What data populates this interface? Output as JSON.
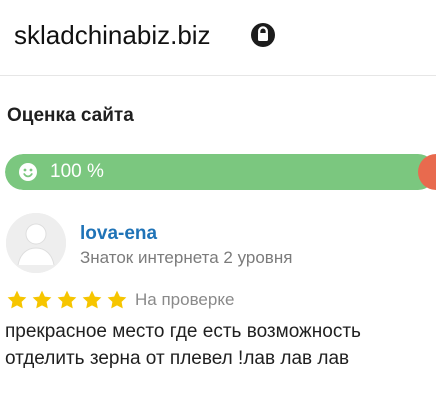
{
  "header": {
    "site_name": "skladchinabiz.biz",
    "lock_icon": "lock-icon"
  },
  "rating": {
    "title": "Оценка сайта",
    "percent_label": "100 %",
    "percent_value": 100,
    "positive_color": "#7bc77f",
    "negative_color": "#e86a4e",
    "icon": "smile-icon"
  },
  "review": {
    "author": "lova-ena",
    "rank": "Знаток интернета 2 уровня",
    "stars": 5,
    "star_color": "#f6c500",
    "status": "На проверке",
    "text": "прекрасное место где есть возможность отделить зерна от плевел !лав лав лав",
    "avatar_icon": "user-avatar-icon"
  },
  "colors": {
    "link": "#1f73b7",
    "muted_text": "#7b7b7b"
  }
}
